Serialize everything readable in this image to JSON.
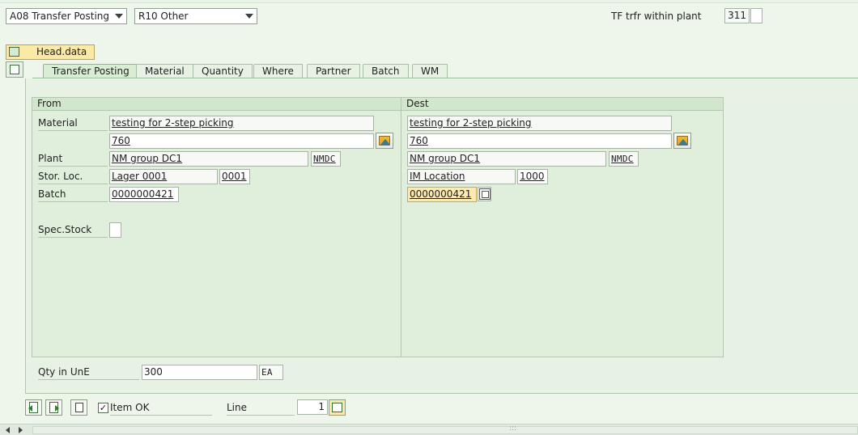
{
  "header": {
    "movement_type_dd": "A08 Transfer Posting",
    "reason_dd": "R10 Other",
    "tf_label": "TF trfr within plant",
    "tf_value": "311"
  },
  "head_data_label": "Head.data",
  "tabs": [
    {
      "label": "Transfer Posting",
      "active": true
    },
    {
      "label": "Material"
    },
    {
      "label": "Quantity"
    },
    {
      "label": "Where"
    },
    {
      "label": "Partner"
    },
    {
      "label": "Batch"
    },
    {
      "label": "WM"
    }
  ],
  "from": {
    "title": "From",
    "material_label": "Material",
    "material_desc": "testing for 2-step picking",
    "material_no": "760",
    "plant_label": "Plant",
    "plant_name": "NM group DC1",
    "plant_code": "NMDC",
    "sloc_label": "Stor. Loc.",
    "sloc_name": "Lager 0001",
    "sloc_code": "0001",
    "batch_label": "Batch",
    "batch_value": "0000000421",
    "spec_stock_label": "Spec.Stock"
  },
  "dest": {
    "title": "Dest",
    "material_desc": "testing for 2-step picking",
    "material_no": "760",
    "plant_name": "NM group DC1",
    "plant_code": "NMDC",
    "sloc_name": "IM Location",
    "sloc_code": "1000",
    "batch_value": "0000000421"
  },
  "qty": {
    "label": "Qty in UnE",
    "value": "300",
    "unit": "EA"
  },
  "footer": {
    "item_ok_label": "Item OK",
    "item_ok_checked": "✓",
    "line_label": "Line",
    "line_value": "1",
    "grip": ":::"
  }
}
